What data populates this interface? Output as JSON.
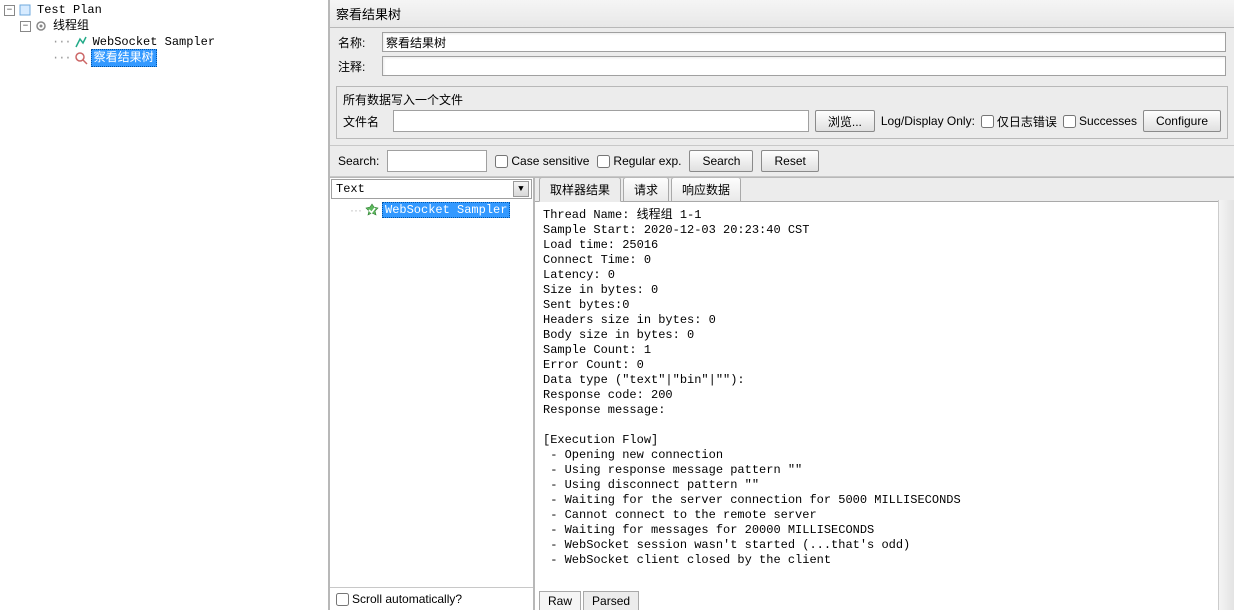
{
  "tree": {
    "root": {
      "label": "Test Plan"
    },
    "thread": {
      "label": "线程组"
    },
    "sampler": {
      "label": "WebSocket Sampler"
    },
    "view": {
      "label": "察看结果树"
    }
  },
  "panel": {
    "title": "察看结果树",
    "name_label": "名称:",
    "name_value": "察看结果树",
    "comment_label": "注释:",
    "comment_value": ""
  },
  "file": {
    "legend": "所有数据写入一个文件",
    "filename_label": "文件名",
    "filename_value": "",
    "browse_btn": "浏览...",
    "logonly_label": "Log/Display Only:",
    "err_only": "仅日志错误",
    "successes": "Successes",
    "configure_btn": "Configure"
  },
  "search": {
    "label": "Search:",
    "value": "",
    "case": "Case sensitive",
    "regex": "Regular exp.",
    "search_btn": "Search",
    "reset_btn": "Reset"
  },
  "results": {
    "renderer": "Text",
    "sample_label": "WebSocket Sampler",
    "scroll_auto": "Scroll automatically?"
  },
  "tabs": {
    "sampler": "取样器结果",
    "request": "请求",
    "response": "响应数据"
  },
  "mini_tabs": {
    "raw": "Raw",
    "parsed": "Parsed"
  },
  "body": "Thread Name: 线程组 1-1\nSample Start: 2020-12-03 20:23:40 CST\nLoad time: 25016\nConnect Time: 0\nLatency: 0\nSize in bytes: 0\nSent bytes:0\nHeaders size in bytes: 0\nBody size in bytes: 0\nSample Count: 1\nError Count: 0\nData type (\"text\"|\"bin\"|\"\"):\nResponse code: 200\nResponse message:\n\n[Execution Flow]\n - Opening new connection\n - Using response message pattern \"\"\n - Using disconnect pattern \"\"\n - Waiting for the server connection for 5000 MILLISECONDS\n - Cannot connect to the remote server\n - Waiting for messages for 20000 MILLISECONDS\n - WebSocket session wasn't started (...that's odd)\n - WebSocket client closed by the client"
}
